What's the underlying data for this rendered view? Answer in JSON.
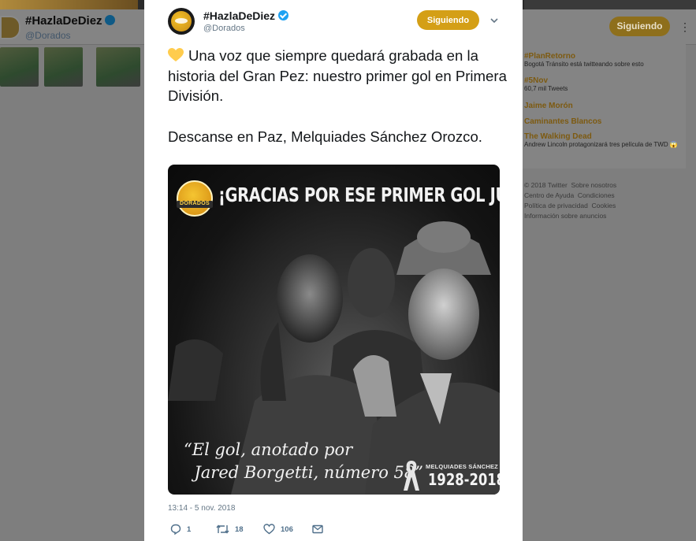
{
  "background": {
    "profile_name": "#HazlaDeDiez",
    "profile_handle": "@Dorados",
    "follow_label": "Siguiendo",
    "trends": [
      {
        "name": "#PlanRetorno",
        "meta": "Bogotá Tránsito está twitteando sobre esto"
      },
      {
        "name": "#5Nov",
        "meta": "60,7 mil Tweets"
      },
      {
        "name": "Jaime Morón",
        "meta": ""
      },
      {
        "name": "Caminantes Blancos",
        "meta": ""
      },
      {
        "name": "The Walking Dead",
        "meta": "Andrew Lincoln protagonizará tres película de TWD 😱"
      }
    ],
    "footer": {
      "copyright": "© 2018 Twitter",
      "about": "Sobre nosotros",
      "help": "Centro de Ayuda",
      "terms": "Condiciones",
      "privacy": "Política de privacidad",
      "cookies": "Cookies",
      "ads": "Información sobre anuncios"
    }
  },
  "tweet": {
    "author_name": "#HazlaDeDiez",
    "author_handle": "@Dorados",
    "follow_label": "Siguiendo",
    "text": "Una voz que siempre quedará grabada en la historia del Gran Pez: nuestro primer gol en Primera División.\n\nDescanse en Paz, Melquiades Sánchez Orozco.",
    "timestamp": "13:14 - 5 nov. 2018",
    "replies": "1",
    "retweets": "18",
    "likes": "106",
    "colors": {
      "accent": "#d49f16",
      "text": "#14171a",
      "muted": "#657786"
    }
  },
  "media": {
    "logo_word": "DORADOS",
    "headline": "¡GRACIAS POR ESE PRIMER GOL JUNTOS!",
    "quote_line1": "“El gol, anotado por",
    "quote_line2": "Jared Borgetti, número 58”",
    "memorial_name": "MELQUIADES SÁNCHEZ OROZCO",
    "memorial_years": "1928-2018"
  }
}
